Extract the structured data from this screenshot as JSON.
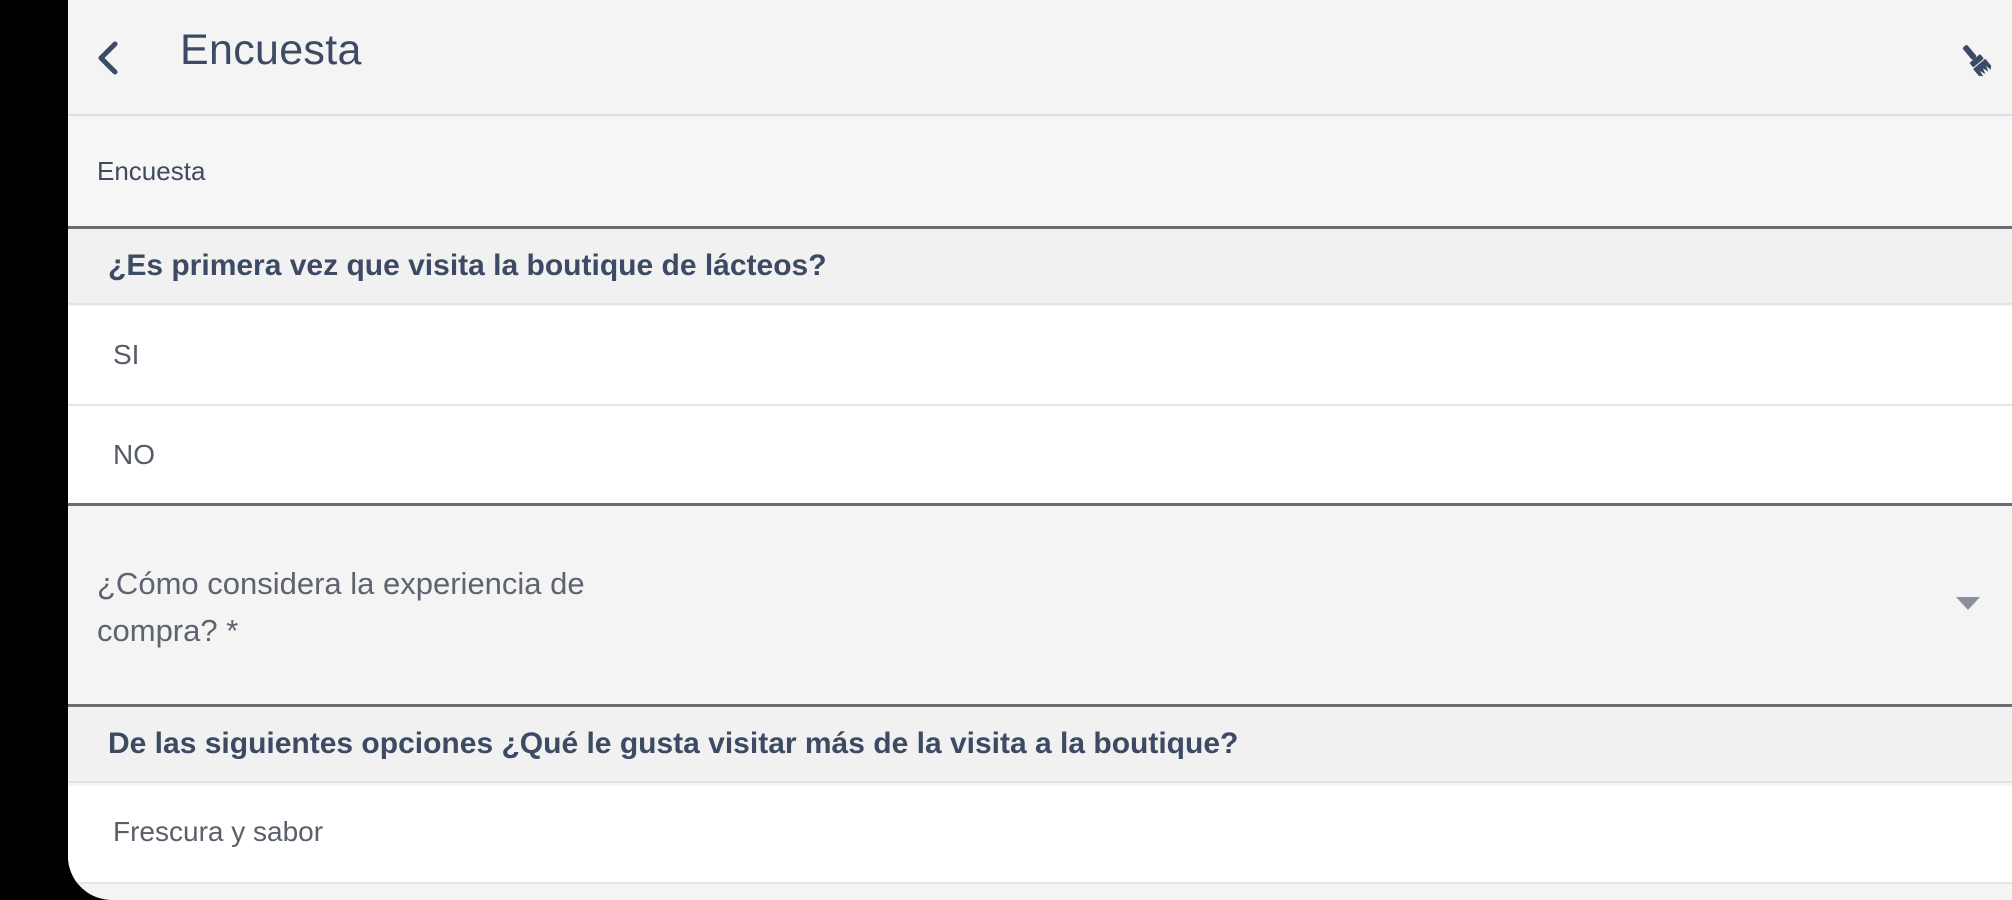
{
  "app_bar": {
    "title": "Encuesta",
    "back_icon": "chevron-left-icon",
    "action_icon": "paint-brush-icon"
  },
  "section": {
    "label": "Encuesta"
  },
  "question_1": {
    "text": "¿Es primera vez que visita la boutique de lácteos?",
    "options": [
      {
        "label": "SI"
      },
      {
        "label": "NO"
      }
    ]
  },
  "question_2": {
    "label": "¿Cómo considera la experiencia de compra? *",
    "selected_value": "",
    "dropdown_icon": "caret-down-icon"
  },
  "question_3": {
    "text": "De las siguientes opciones ¿Qué le gusta visitar más de la visita a la boutique?",
    "options": [
      {
        "label": "Frescura y sabor"
      }
    ]
  },
  "colors": {
    "text_primary": "#3c4a64",
    "background": "#f5f5f5",
    "divider": "#6a6d72"
  }
}
